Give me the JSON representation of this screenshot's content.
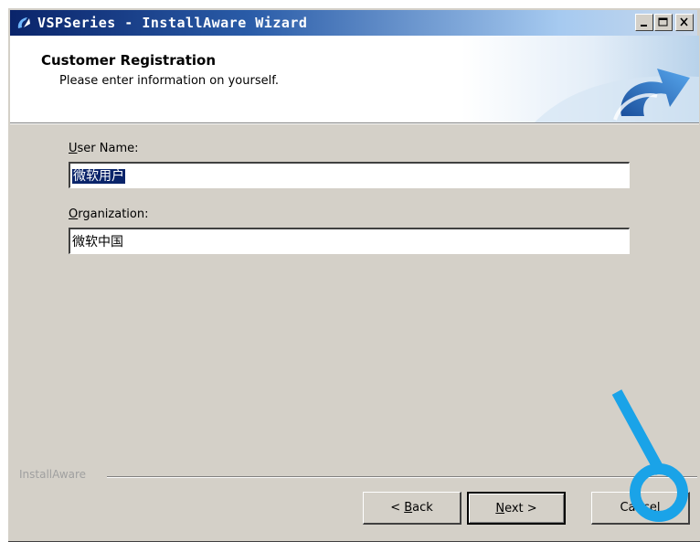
{
  "window": {
    "title": "VSPSeries - InstallAware Wizard"
  },
  "header": {
    "title": "Customer Registration",
    "subtitle": "Please enter information on yourself."
  },
  "form": {
    "user_name": {
      "label_accel": "U",
      "label_rest": "ser Name:",
      "value": "微软用户"
    },
    "organization": {
      "label_accel": "O",
      "label_rest": "rganization:",
      "value": "微软中国"
    }
  },
  "footer": {
    "brand": "InstallAware",
    "back": {
      "pre": "< ",
      "accel": "B",
      "rest": "ack"
    },
    "next": {
      "accel": "N",
      "rest": "ext >"
    },
    "cancel": "Cancel"
  },
  "icons": [
    "app-icon",
    "minimize-icon",
    "maximize-icon",
    "close-icon",
    "header-arrow-icon",
    "watermark-logo-icon"
  ],
  "colors": {
    "title_start": "#0a246a",
    "selection": "#0a246a",
    "dialog": "#d4d0c8",
    "logo": "#1aa3e8"
  }
}
